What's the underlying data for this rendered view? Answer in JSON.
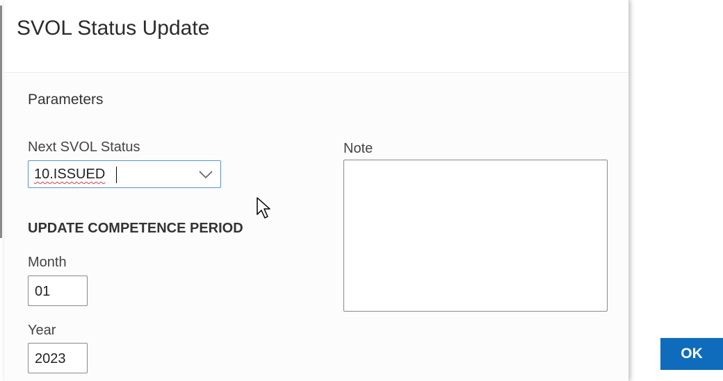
{
  "dialog": {
    "title": "SVOL Status Update"
  },
  "parameters": {
    "section_title": "Parameters",
    "next_status": {
      "label": "Next SVOL Status",
      "value": "10.ISSUED",
      "icon": "chevron-down-icon"
    },
    "note": {
      "label": "Note",
      "value": ""
    },
    "competence_period": {
      "heading": "UPDATE COMPETENCE PERIOD",
      "month": {
        "label": "Month",
        "value": "01"
      },
      "year": {
        "label": "Year",
        "value": "2023"
      }
    }
  },
  "actions": {
    "ok_label": "OK"
  },
  "colors": {
    "accent": "#0f6cbd",
    "focus_border": "#5b8fd6",
    "spellcheck": "#d23b3b"
  }
}
